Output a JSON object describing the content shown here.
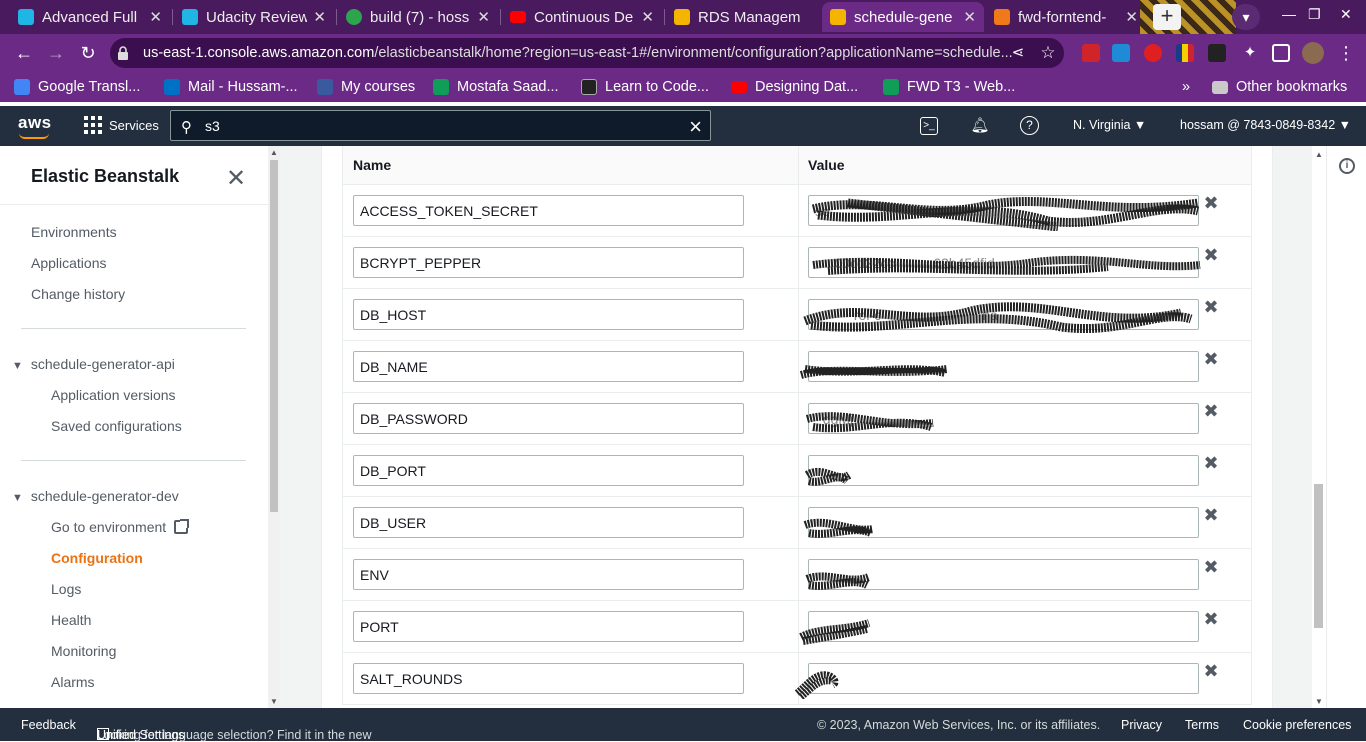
{
  "browser": {
    "tabs": [
      {
        "label": "Advanced Full",
        "icon_color": "#1fb6e6",
        "icon": "udacity-icon"
      },
      {
        "label": "Udacity Review",
        "icon_color": "#1fb6e6",
        "icon": "udacity-icon"
      },
      {
        "label": "build (7) - hoss",
        "icon_color": "#2da44e",
        "icon": "circleci-icon"
      },
      {
        "label": "Continuous De",
        "icon_color": "#ff0000",
        "icon": "youtube-icon"
      },
      {
        "label": "RDS Managem",
        "icon_color": "#f5b400",
        "icon": "aws-cube-icon"
      },
      {
        "label": "schedule-gene",
        "icon_color": "#f5b400",
        "icon": "aws-cube-icon",
        "active": true
      },
      {
        "label": "fwd-forntend-",
        "icon_color": "#f07a1a",
        "icon": "aws-box-icon"
      }
    ],
    "url_domain": "us-east-1.console.aws.amazon.com",
    "url_path": "/elasticbeanstalk/home?region=us-east-1#/environment/configuration?applicationName=schedule...",
    "bookmarks": [
      {
        "label": "Google Transl...",
        "icon_color": "#4285f4"
      },
      {
        "label": "Mail - Hussam-...",
        "icon_color": "#0072c6"
      },
      {
        "label": "My courses",
        "icon_color": "#3a5aa0"
      },
      {
        "label": "Mostafa Saad...",
        "icon_color": "#0f9d58"
      },
      {
        "label": "Learn to Code...",
        "icon_color": "#222222"
      },
      {
        "label": "Designing Dat...",
        "icon_color": "#ff0000"
      },
      {
        "label": "FWD T3 - Web...",
        "icon_color": "#0f9d58"
      }
    ],
    "other_bookmarks": "Other bookmarks",
    "more_bookmarks": "»"
  },
  "aws_nav": {
    "logo": "aws",
    "services_label": "Services",
    "search_value": "s3",
    "region": "N. Virginia",
    "account": "hossam @ 7843-0849-8342"
  },
  "sidebar": {
    "title": "Elastic Beanstalk",
    "top_items": [
      "Environments",
      "Applications",
      "Change history"
    ],
    "app_group": "schedule-generator-api",
    "app_items": [
      "Application versions",
      "Saved configurations"
    ],
    "env_group": "schedule-generator-dev",
    "env_items": [
      "Go to environment",
      "Configuration",
      "Logs",
      "Health",
      "Monitoring",
      "Alarms"
    ]
  },
  "table": {
    "name_header": "Name",
    "value_header": "Value",
    "rows": [
      {
        "name": "ACCESS_TOKEN_SECRET",
        "value": "se"
      },
      {
        "name": "BCRYPT_PEPPER",
        "value": "     00cd22cc          62b45dfid"
      },
      {
        "name": "DB_HOST",
        "value": "          rol-c                          na"
      },
      {
        "name": "DB_NAME",
        "value": ""
      },
      {
        "name": "DB_PASSWORD",
        "value": "  dgMj"
      },
      {
        "name": "DB_PORT",
        "value": ""
      },
      {
        "name": "DB_USER",
        "value": ""
      },
      {
        "name": "ENV",
        "value": ""
      },
      {
        "name": "PORT",
        "value": ""
      },
      {
        "name": "SALT_ROUNDS",
        "value": ""
      }
    ]
  },
  "footer": {
    "feedback": "Feedback",
    "lang_text": "Looking for language selection? Find it in the new",
    "unified_settings": "Unified Settings",
    "copyright": "© 2023, Amazon Web Services, Inc. or its affiliates.",
    "privacy": "Privacy",
    "terms": "Terms",
    "cookie": "Cookie preferences"
  },
  "colors": {
    "browser_frame": "#6a2a86",
    "aws_nav": "#232f3e",
    "accent": "#ec7211"
  }
}
